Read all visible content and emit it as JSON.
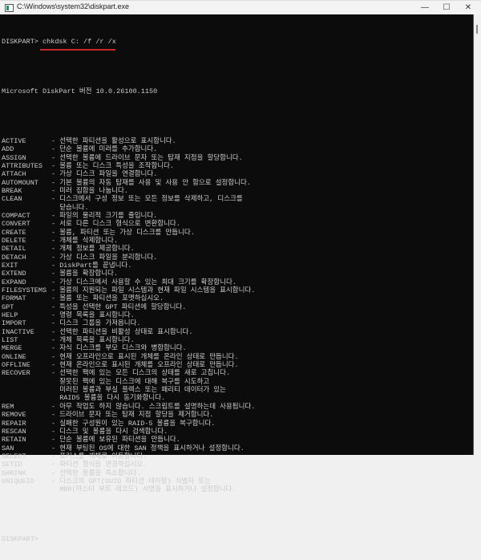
{
  "window": {
    "title": "C:\\Windows\\system32\\diskpart.exe",
    "minimize": "—",
    "maximize": "☐",
    "close": "✕"
  },
  "prompt": "DISKPART> ",
  "typed_command": "chkdsk C: /f /r /x",
  "version_line": "Microsoft DiskPart 버전 10.0.26100.1150",
  "commands": [
    {
      "name": "ACTIVE",
      "desc": [
        "- 선택한 파티션을 활성으로 표시합니다."
      ]
    },
    {
      "name": "ADD",
      "desc": [
        "- 단순 볼륨에 미러를 추가합니다."
      ]
    },
    {
      "name": "ASSIGN",
      "desc": [
        "- 선택한 볼륨에 드라이브 문자 또는 탑재 지점을 할당합니다."
      ]
    },
    {
      "name": "ATTRIBUTES",
      "desc": [
        "- 볼륨 또는 디스크 특성을 조작합니다."
      ]
    },
    {
      "name": "ATTACH",
      "desc": [
        "- 가상 디스크 파일을 연결합니다."
      ]
    },
    {
      "name": "AUTOMOUNT",
      "desc": [
        "- 기본 볼륨의 자동 탑재를 사용 및 사용 안 함으로 설정합니다."
      ]
    },
    {
      "name": "BREAK",
      "desc": [
        "- 미러 집합을 나눕니다."
      ]
    },
    {
      "name": "CLEAN",
      "desc": [
        "- 디스크에서 구성 정보 또는 모든 정보를 삭제하고, 디스크를",
        "  닫습니다."
      ]
    },
    {
      "name": "COMPACT",
      "desc": [
        "- 파일의 물리적 크기를 줄입니다."
      ]
    },
    {
      "name": "CONVERT",
      "desc": [
        "- 서로 다른 디스크 형식으로 변환합니다."
      ]
    },
    {
      "name": "CREATE",
      "desc": [
        "- 볼륨, 파티션 또는 가상 디스크를 만듭니다."
      ]
    },
    {
      "name": "DELETE",
      "desc": [
        "- 개체를 삭제합니다."
      ]
    },
    {
      "name": "DETAIL",
      "desc": [
        "- 개체 정보를 제공합니다."
      ]
    },
    {
      "name": "DETACH",
      "desc": [
        "- 가상 디스크 파일을 분리합니다."
      ]
    },
    {
      "name": "EXIT",
      "desc": [
        "- DiskPart를 끝냅니다."
      ]
    },
    {
      "name": "EXTEND",
      "desc": [
        "- 볼륨을 확장합니다."
      ]
    },
    {
      "name": "EXPAND",
      "desc": [
        "- 가상 디스크에서 사용할 수 있는 최대 크기를 확장합니다."
      ]
    },
    {
      "name": "FILESYSTEMS",
      "desc": [
        "- 볼륨의 지원되는 파일 시스템과 현재 파일 시스템을 표시합니다."
      ]
    },
    {
      "name": "FORMAT",
      "desc": [
        "- 볼륨 또는 파티션을 포맷하십시오."
      ]
    },
    {
      "name": "GPT",
      "desc": [
        "- 특성을 선택한 GPT 파티션에 할당합니다."
      ]
    },
    {
      "name": "HELP",
      "desc": [
        "- 명령 목록을 표시합니다."
      ]
    },
    {
      "name": "IMPORT",
      "desc": [
        "- 디스크 그룹을 가져옵니다."
      ]
    },
    {
      "name": "INACTIVE",
      "desc": [
        "- 선택한 파티션을 비활성 상태로 표시합니다."
      ]
    },
    {
      "name": "LIST",
      "desc": [
        "- 개체 목록을 표시합니다."
      ]
    },
    {
      "name": "MERGE",
      "desc": [
        "- 자식 디스크를 부모 디스크와 병합합니다."
      ]
    },
    {
      "name": "ONLINE",
      "desc": [
        "- 현재 오프라인으로 표시된 개체를 온라인 상태로 만듭니다."
      ]
    },
    {
      "name": "OFFLINE",
      "desc": [
        "- 현재 온라인으로 표시된 개체를 오프라인 상태로 만듭니다."
      ]
    },
    {
      "name": "RECOVER",
      "desc": [
        "- 선택한 팩에 있는 모든 디스크의 상태를 새로 고칩니다.",
        "  잘못된 팩에 있는 디스크에 대해 복구를 시도하고",
        "  미러된 볼륨과 부실 플렉스 또는 패리티 데이터가 있는",
        "  RAID5 볼륨을 다시 동기화합니다."
      ]
    },
    {
      "name": "REM",
      "desc": [
        "- 아무 작업도 하지 않습니다. 스크립트를 설명하는데 사용됩니다."
      ]
    },
    {
      "name": "REMOVE",
      "desc": [
        "- 드라이브 문자 또는 탑재 지점 할당을 제거합니다."
      ]
    },
    {
      "name": "REPAIR",
      "desc": [
        "- 실패한 구성원이 있는 RAID-5 볼륨을 복구합니다."
      ]
    },
    {
      "name": "RESCAN",
      "desc": [
        "- 디스크 및 볼륨을 다시 검색합니다."
      ]
    },
    {
      "name": "RETAIN",
      "desc": [
        "- 단순 볼륨에 보유된 파티션을 만듭니다."
      ]
    },
    {
      "name": "SAN",
      "desc": [
        "- 현재 부팅된 OS에 대한 SAN 정책을 표시하거나 설정합니다."
      ]
    },
    {
      "name": "SELECT",
      "desc": [
        "- 포커스를 개체로 이동합니다."
      ]
    },
    {
      "name": "SETID",
      "desc": [
        "- 파티션 형식을 변경하십시오."
      ]
    },
    {
      "name": "SHRINK",
      "desc": [
        "- 선택한 볼륨을 축소합니다."
      ]
    },
    {
      "name": "UNIQUEID",
      "desc": [
        "- 디스크의 GPT(GUID 파티션 테이블) 식별자 또는",
        "  MBR(마스터 부트 레코드) 서명을 표시하거나 설정합니다."
      ]
    }
  ],
  "final_prompt": "DISKPART>"
}
